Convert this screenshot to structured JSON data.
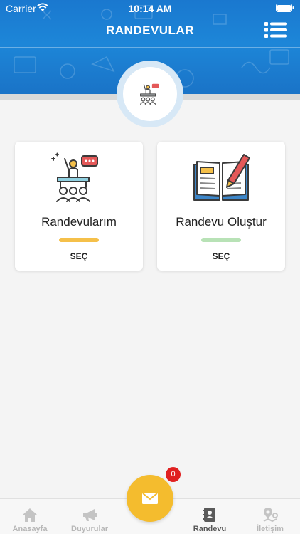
{
  "status_bar": {
    "carrier": "Carrier",
    "time": "10:14 AM"
  },
  "header": {
    "title": "RANDEVULAR"
  },
  "cards": [
    {
      "title": "Randevularım",
      "select_label": "SEÇ",
      "bar_color": "#f5c04a"
    },
    {
      "title": "Randevu Oluştur",
      "select_label": "SEÇ",
      "bar_color": "#b8e2b6"
    }
  ],
  "fab": {
    "badge_count": "0"
  },
  "tabbar": {
    "items": [
      {
        "label": "Anasayfa",
        "icon": "home-icon"
      },
      {
        "label": "Duyurular",
        "icon": "megaphone-icon"
      },
      {
        "label": "Randevu",
        "icon": "contact-book-icon",
        "active": true
      },
      {
        "label": "İletişim",
        "icon": "map-pin-icon"
      }
    ]
  },
  "colors": {
    "primary": "#1d86d8",
    "accent": "#f4bc2e",
    "badge": "#e02020"
  }
}
